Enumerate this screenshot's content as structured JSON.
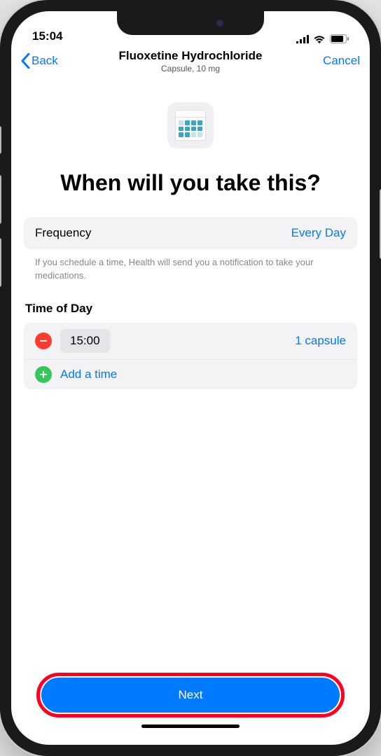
{
  "status": {
    "time": "15:04"
  },
  "nav": {
    "back": "Back",
    "title": "Fluoxetine Hydrochloride",
    "subtitle": "Capsule, 10 mg",
    "cancel": "Cancel"
  },
  "hero": {
    "heading": "When will you take this?"
  },
  "frequency": {
    "label": "Frequency",
    "value": "Every Day"
  },
  "hint": "If you schedule a time, Health will send you a notification to take your medications.",
  "time_section": {
    "title": "Time of Day"
  },
  "times": [
    {
      "time": "15:00",
      "dose": "1 capsule"
    }
  ],
  "add_time": "Add a time",
  "footer": {
    "next": "Next"
  }
}
